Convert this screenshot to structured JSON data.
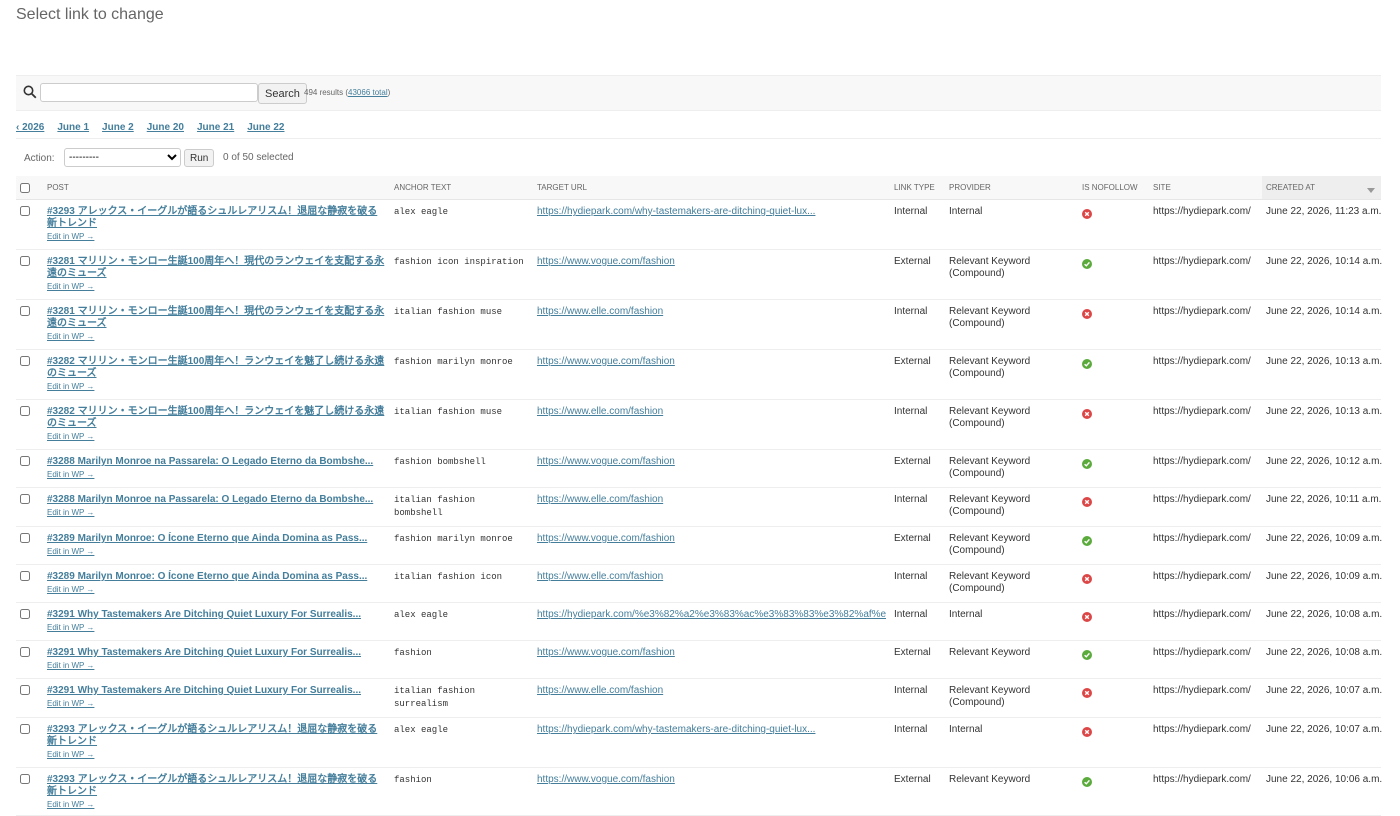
{
  "header": {
    "title": "Select link to change"
  },
  "toolbar": {
    "search_placeholder": "",
    "search_label": "Search",
    "results_prefix": "494 results (",
    "total_link": "43066 total",
    "results_suffix": ")"
  },
  "date_hierarchy": [
    "‹ 2026",
    "June 1",
    "June 2",
    "June 20",
    "June 21",
    "June 22"
  ],
  "actions": {
    "label": "Action:",
    "selected_option": "---------",
    "run_label": "Run",
    "selected_count": "0 of 50 selected"
  },
  "table": {
    "columns": [
      "Post",
      "Anchor text",
      "Target URL",
      "Link type",
      "Provider",
      "Is nofollow",
      "Site",
      "Created at"
    ],
    "rows": [
      {
        "post": "#3293 アレックス・イーグルが語るシュルレアリスム！退屈な静寂を破る新トレンド",
        "edit": "Edit in WP →",
        "anchor": "alex eagle",
        "url": "https://hydiepark.com/why-tastemakers-are-ditching-quiet-lux...",
        "link_type": "Internal",
        "provider": "Internal",
        "nofollow": false,
        "site": "https://hydiepark.com/",
        "created": "June 22, 2026, 11:23 a.m."
      },
      {
        "post": "#3281 マリリン・モンロー生誕100周年へ！現代のランウェイを支配する永遠のミューズ",
        "edit": "Edit in WP →",
        "anchor": "fashion icon inspiration",
        "url": "https://www.vogue.com/fashion",
        "link_type": "External",
        "provider": "Relevant Keyword (Compound)",
        "nofollow": true,
        "site": "https://hydiepark.com/",
        "created": "June 22, 2026, 10:14 a.m."
      },
      {
        "post": "#3281 マリリン・モンロー生誕100周年へ！現代のランウェイを支配する永遠のミューズ",
        "edit": "Edit in WP →",
        "anchor": "italian fashion muse",
        "url": "https://www.elle.com/fashion",
        "link_type": "Internal",
        "provider": "Relevant Keyword (Compound)",
        "nofollow": false,
        "site": "https://hydiepark.com/",
        "created": "June 22, 2026, 10:14 a.m."
      },
      {
        "post": "#3282 マリリン・モンロー生誕100周年へ！ランウェイを魅了し続ける永遠のミューズ",
        "edit": "Edit in WP →",
        "anchor": "fashion marilyn monroe",
        "url": "https://www.vogue.com/fashion",
        "link_type": "External",
        "provider": "Relevant Keyword (Compound)",
        "nofollow": true,
        "site": "https://hydiepark.com/",
        "created": "June 22, 2026, 10:13 a.m."
      },
      {
        "post": "#3282 マリリン・モンロー生誕100周年へ！ランウェイを魅了し続ける永遠のミューズ",
        "edit": "Edit in WP →",
        "anchor": "italian fashion muse",
        "url": "https://www.elle.com/fashion",
        "link_type": "Internal",
        "provider": "Relevant Keyword (Compound)",
        "nofollow": false,
        "site": "https://hydiepark.com/",
        "created": "June 22, 2026, 10:13 a.m."
      },
      {
        "post": "#3288 Marilyn Monroe na Passarela: O Legado Eterno da Bombshe...",
        "edit": "Edit in WP →",
        "anchor": "fashion bombshell",
        "url": "https://www.vogue.com/fashion",
        "link_type": "External",
        "provider": "Relevant Keyword (Compound)",
        "nofollow": true,
        "site": "https://hydiepark.com/",
        "created": "June 22, 2026, 10:12 a.m."
      },
      {
        "post": "#3288 Marilyn Monroe na Passarela: O Legado Eterno da Bombshe...",
        "edit": "Edit in WP →",
        "anchor": "italian fashion bombshell",
        "url": "https://www.elle.com/fashion",
        "link_type": "Internal",
        "provider": "Relevant Keyword (Compound)",
        "nofollow": false,
        "site": "https://hydiepark.com/",
        "created": "June 22, 2026, 10:11 a.m."
      },
      {
        "post": "#3289 Marilyn Monroe: O Ícone Eterno que Ainda Domina as Pass...",
        "edit": "Edit in WP →",
        "anchor": "fashion marilyn monroe",
        "url": "https://www.vogue.com/fashion",
        "link_type": "External",
        "provider": "Relevant Keyword (Compound)",
        "nofollow": true,
        "site": "https://hydiepark.com/",
        "created": "June 22, 2026, 10:09 a.m."
      },
      {
        "post": "#3289 Marilyn Monroe: O Ícone Eterno que Ainda Domina as Pass...",
        "edit": "Edit in WP →",
        "anchor": "italian fashion icon",
        "url": "https://www.elle.com/fashion",
        "link_type": "Internal",
        "provider": "Relevant Keyword (Compound)",
        "nofollow": false,
        "site": "https://hydiepark.com/",
        "created": "June 22, 2026, 10:09 a.m."
      },
      {
        "post": "#3291 Why Tastemakers Are Ditching Quiet Luxury For Surrealis...",
        "edit": "Edit in WP →",
        "anchor": "alex eagle",
        "url": "https://hydiepark.com/%e3%82%a2%e3%83%ac%e3%83%83%e3%82%af%e...",
        "link_type": "Internal",
        "provider": "Internal",
        "nofollow": false,
        "site": "https://hydiepark.com/",
        "created": "June 22, 2026, 10:08 a.m."
      },
      {
        "post": "#3291 Why Tastemakers Are Ditching Quiet Luxury For Surrealis...",
        "edit": "Edit in WP →",
        "anchor": "fashion",
        "url": "https://www.vogue.com/fashion",
        "link_type": "External",
        "provider": "Relevant Keyword",
        "nofollow": true,
        "site": "https://hydiepark.com/",
        "created": "June 22, 2026, 10:08 a.m."
      },
      {
        "post": "#3291 Why Tastemakers Are Ditching Quiet Luxury For Surrealis...",
        "edit": "Edit in WP →",
        "anchor": "italian fashion surrealism",
        "url": "https://www.elle.com/fashion",
        "link_type": "Internal",
        "provider": "Relevant Keyword (Compound)",
        "nofollow": false,
        "site": "https://hydiepark.com/",
        "created": "June 22, 2026, 10:07 a.m."
      },
      {
        "post": "#3293 アレックス・イーグルが語るシュルレアリスム！退屈な静寂を破る新トレンド",
        "edit": "Edit in WP →",
        "anchor": "alex eagle",
        "url": "https://hydiepark.com/why-tastemakers-are-ditching-quiet-lux...",
        "link_type": "Internal",
        "provider": "Internal",
        "nofollow": false,
        "site": "https://hydiepark.com/",
        "created": "June 22, 2026, 10:07 a.m."
      },
      {
        "post": "#3293 アレックス・イーグルが語るシュルレアリスム！退屈な静寂を破る新トレンド",
        "edit": "Edit in WP →",
        "anchor": "fashion",
        "url": "https://www.vogue.com/fashion",
        "link_type": "External",
        "provider": "Relevant Keyword",
        "nofollow": true,
        "site": "https://hydiepark.com/",
        "created": "June 22, 2026, 10:06 a.m."
      }
    ]
  },
  "colors": {
    "link": "#447e9b",
    "yes": "#5aab3c",
    "no": "#dd4646"
  },
  "icons": {
    "search": "search-icon",
    "yes": "check-circle-icon",
    "no": "x-circle-icon"
  }
}
